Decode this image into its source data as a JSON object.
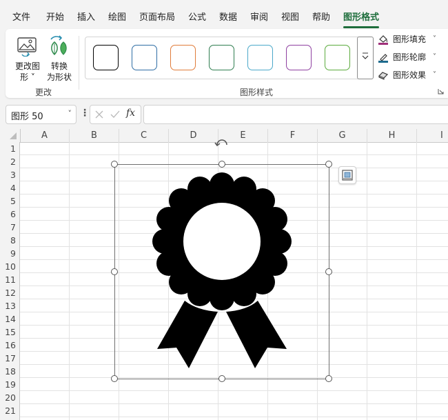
{
  "menu": {
    "tabs": [
      {
        "label": "文件"
      },
      {
        "label": "开始"
      },
      {
        "label": "插入"
      },
      {
        "label": "绘图"
      },
      {
        "label": "页面布局"
      },
      {
        "label": "公式"
      },
      {
        "label": "数据"
      },
      {
        "label": "审阅"
      },
      {
        "label": "视图"
      },
      {
        "label": "帮助"
      },
      {
        "label": "图形格式"
      }
    ],
    "active_tab": "图形格式"
  },
  "ribbon": {
    "change_group": {
      "change_graphic_label_line1": "更改图",
      "change_graphic_label_line2": "形 ˅",
      "convert_label_line1": "转换",
      "convert_label_line2": "为形状",
      "group_label": "更改"
    },
    "styles_group": {
      "group_label": "图形样式",
      "swatch_colors": [
        "#000000",
        "#2e6da4",
        "#e07b39",
        "#2e7d4f",
        "#4aa8c9",
        "#8e3fa0",
        "#5aaa3c"
      ]
    },
    "format_commands": {
      "fill_label": "图形填充",
      "outline_label": "图形轮廓",
      "effects_label": "图形效果",
      "fill_color": "#a0307a",
      "outline_color": "#1e6b8e"
    }
  },
  "formula_bar": {
    "name_box": "图形 50",
    "fx_label": "fx",
    "formula": ""
  },
  "sheet": {
    "columns": [
      "A",
      "B",
      "C",
      "D",
      "E",
      "F",
      "G",
      "H",
      "I"
    ],
    "rows": [
      "1",
      "2",
      "3",
      "4",
      "5",
      "6",
      "7",
      "8",
      "9",
      "10",
      "11",
      "12",
      "13",
      "14",
      "15",
      "16",
      "17",
      "18",
      "19",
      "20",
      "21"
    ]
  },
  "shape": {
    "name": "award-ribbon-graphic",
    "fill_color": "#000000"
  }
}
